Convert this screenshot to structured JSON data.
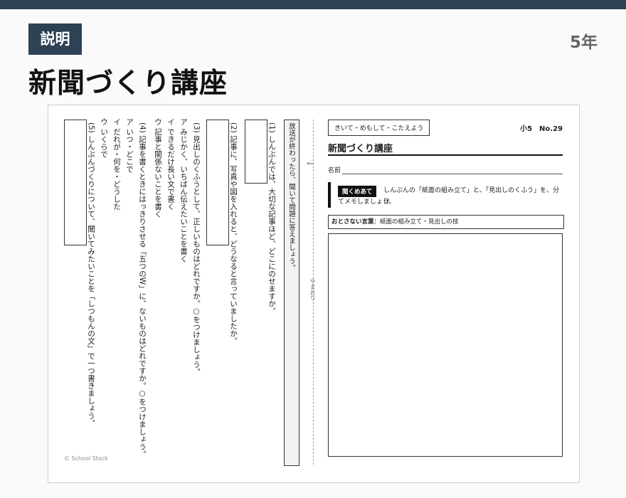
{
  "header": {
    "badge": "説明",
    "grade": "5年",
    "title": "新聞づくり講座"
  },
  "left_page": {
    "instruction": "放送が終わったら、聞いて問題に答えましょう。",
    "q1": "(1) しんぶんでは、大切な記事ほど、どこにのせますか。",
    "q2": "(2) 記事に、写真や図を入れると、どうなると言っていましたか。",
    "q3": "(3) 見出しのくふうとして、正しいものはどれですか。○をつけましょう。",
    "q3_a": "ア みじかく、いちばん伝えたいことを書く",
    "q3_i": "イ できるだけ長い文で書く",
    "q3_u": "ウ 記事と関係ないことを書く",
    "q4": "(4) 記事を書くときにはっきりさせる「五つのW」に、ないものはどれですか。○をつけましょう。",
    "q4_a": "ア いつ・どこで",
    "q4_i": "イ だれが・何を・どうした",
    "q4_u": "ウ いくらで",
    "q5": "(5) しんぶんづくりについて、聞いてみたいことを「しつもんの文」で一つ書きましょう。",
    "fold_label": "やまおり",
    "copyright": "© School Stock"
  },
  "right_page": {
    "tag": "きいて・めもして・こたえよう",
    "number": "小5　No.29",
    "title": "新聞づくり講座",
    "name_label": "名前",
    "instruction_tag": "聞くめあて",
    "instruction_line1": "しんぶんの「紙面の組み立て」と、「見出しのくふう」を、分け",
    "instruction_line2": "てメモしましょう。",
    "hint_label": "おとさない言葉",
    "hint_text": "：紙面の組み立て・見出しの技"
  }
}
